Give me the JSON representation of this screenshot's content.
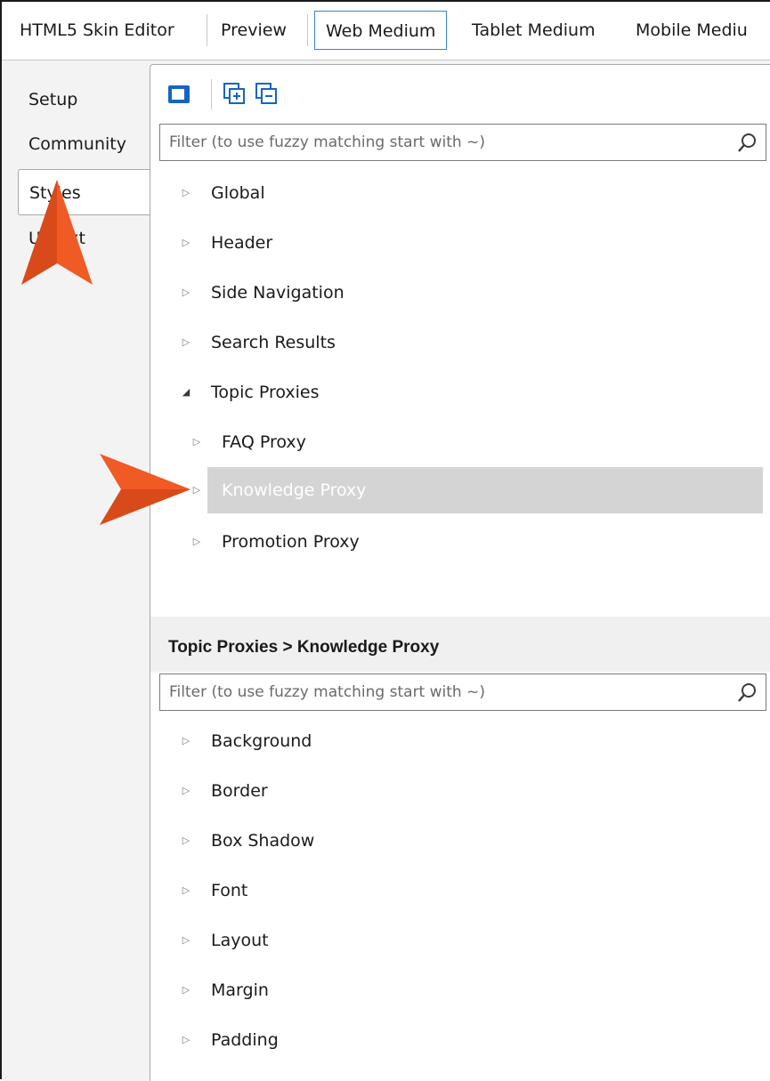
{
  "top_tabs": [
    {
      "label": "HTML5 Skin Editor",
      "active": false
    },
    {
      "label": "Preview",
      "active": false
    },
    {
      "label": "Web Medium",
      "active": true
    },
    {
      "label": "Tablet Medium",
      "active": false
    },
    {
      "label": "Mobile Mediu",
      "active": false
    }
  ],
  "side_tabs": [
    {
      "label": "Setup",
      "active": false
    },
    {
      "label": "Community",
      "active": false
    },
    {
      "label": "Styles",
      "active": true
    },
    {
      "label": "UI Text",
      "active": false
    }
  ],
  "upper_filter": {
    "placeholder": "Filter (to use fuzzy matching start with ~)"
  },
  "upper_tree": [
    {
      "label": "Global",
      "expanded": false,
      "level": 0
    },
    {
      "label": "Header",
      "expanded": false,
      "level": 0
    },
    {
      "label": "Side Navigation",
      "expanded": false,
      "level": 0
    },
    {
      "label": "Search Results",
      "expanded": false,
      "level": 0
    },
    {
      "label": "Topic Proxies",
      "expanded": true,
      "level": 0
    },
    {
      "label": "FAQ Proxy",
      "expanded": false,
      "level": 1
    },
    {
      "label": "Knowledge Proxy",
      "expanded": false,
      "level": 1,
      "selected": true
    },
    {
      "label": "Promotion Proxy",
      "expanded": false,
      "level": 1
    }
  ],
  "property_path": "Topic Proxies > Knowledge Proxy",
  "lower_filter": {
    "placeholder": "Filter (to use fuzzy matching start with ~)"
  },
  "lower_tree": [
    {
      "label": "Background"
    },
    {
      "label": "Border"
    },
    {
      "label": "Box Shadow"
    },
    {
      "label": "Font"
    },
    {
      "label": "Layout"
    },
    {
      "label": "Margin"
    },
    {
      "label": "Padding"
    }
  ],
  "colors": {
    "accent_blue": "#1565c0",
    "callout_orange": "#f05a24",
    "selection_gray": "#d4d4d4"
  }
}
